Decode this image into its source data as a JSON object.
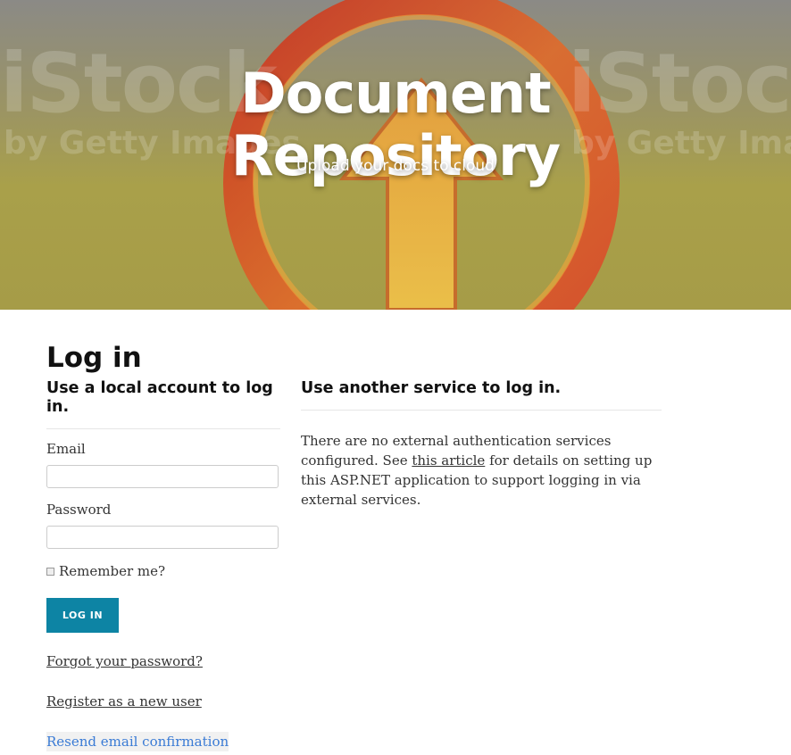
{
  "hero": {
    "title_line1": "Document",
    "title_line2": "Repository",
    "subtitle": "Upload your docs to cloud",
    "watermark_main": "iStock",
    "watermark_sub": "by Getty Images",
    "colors": {
      "ring": "#d8442a",
      "arrow": "#e8a23a",
      "background": "#a69c47"
    }
  },
  "page": {
    "title": "Log in"
  },
  "local": {
    "heading": "Use a local account to log in.",
    "email_label": "Email",
    "email_value": "",
    "password_label": "Password",
    "password_value": "",
    "remember_label": "Remember me?",
    "login_button": "LOG IN",
    "forgot_link": "Forgot your password?",
    "register_link": "Register as a new user",
    "resend_link": "Resend email confirmation"
  },
  "external": {
    "heading": "Use another service to log in.",
    "text_before": "There are no external authentication services configured. See ",
    "article_link": "this article",
    "text_after": " for details on setting up this ASP.NET application to support logging in via external services."
  },
  "colors": {
    "button": "#0d84a4",
    "link_blue": "#3a7bd5"
  }
}
